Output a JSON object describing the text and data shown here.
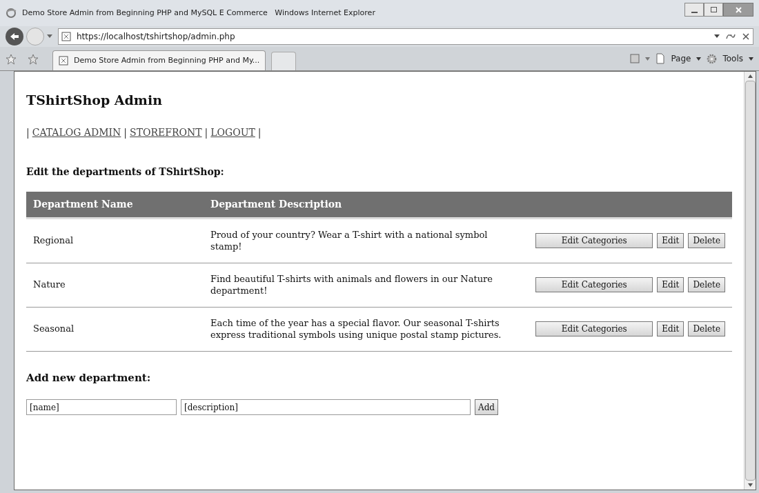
{
  "window": {
    "title": "Demo Store Admin from Beginning PHP and MySQL E Commerce   Windows Internet Explorer"
  },
  "address_bar": {
    "url": "https://localhost/tshirtshop/admin.php"
  },
  "tabs": [
    {
      "label": "Demo Store Admin from Beginning PHP and My...",
      "selected": true
    }
  ],
  "command_bar": {
    "page": "Page",
    "tools": "Tools"
  },
  "page": {
    "title": "TShirtShop Admin",
    "nav": {
      "separator": "|",
      "links": [
        "CATALOG ADMIN",
        "STOREFRONT",
        "LOGOUT"
      ]
    },
    "section_title": "Edit the departments of TShirtShop:",
    "table": {
      "columns": [
        "Department Name",
        "Department Description"
      ],
      "rows": [
        {
          "name": "Regional",
          "description": "Proud of your country? Wear a T-shirt with a national symbol stamp!",
          "buttons": [
            "Edit Categories",
            "Edit",
            "Delete"
          ]
        },
        {
          "name": "Nature",
          "description": "Find beautiful T-shirts with animals and flowers in our Nature department!",
          "buttons": [
            "Edit Categories",
            "Edit",
            "Delete"
          ]
        },
        {
          "name": "Seasonal",
          "description": "Each time of the year has a special flavor. Our seasonal T-shirts express traditional symbols using unique postal stamp pictures.",
          "buttons": [
            "Edit Categories",
            "Edit",
            "Delete"
          ]
        }
      ]
    },
    "add_title": "Add new department:",
    "add_form": {
      "name_value": "[name]",
      "description_value": "[description]",
      "button": "Add"
    }
  }
}
